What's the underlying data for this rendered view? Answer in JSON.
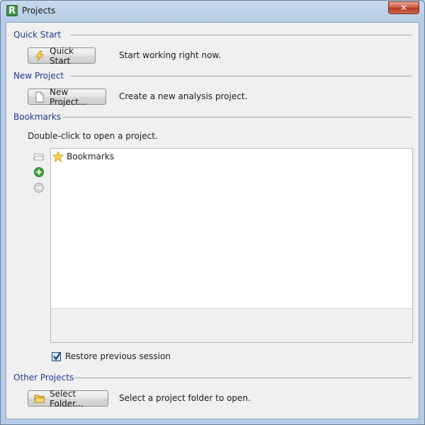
{
  "window": {
    "title": "Projects",
    "app_icon_letter": "R",
    "close_glyph": "✕"
  },
  "sections": {
    "quick_start": {
      "label": "Quick Start",
      "button_label": "Quick Start",
      "button_icon": "lightning-icon",
      "description": "Start working right now."
    },
    "new_project": {
      "label": "New Project",
      "button_label": "New Project...",
      "button_icon": "blank-document-icon",
      "description": "Create a new analysis project."
    },
    "bookmarks": {
      "label": "Bookmarks",
      "hint": "Double-click to open a project.",
      "side_icons": [
        "folder-open-icon",
        "add-icon",
        "remove-icon"
      ],
      "items": [
        {
          "label": "Bookmarks",
          "icon": "star-icon"
        }
      ],
      "restore_label": "Restore previous session",
      "restore_checked": true
    },
    "other_projects": {
      "label": "Other Projects",
      "button_label": "Select Folder...",
      "button_icon": "folder-icon",
      "description": "Select a project folder to open."
    }
  },
  "colors": {
    "section_label": "#1c3a8a",
    "window_frame": "#b4cce6",
    "close_button": "#c9503a"
  }
}
